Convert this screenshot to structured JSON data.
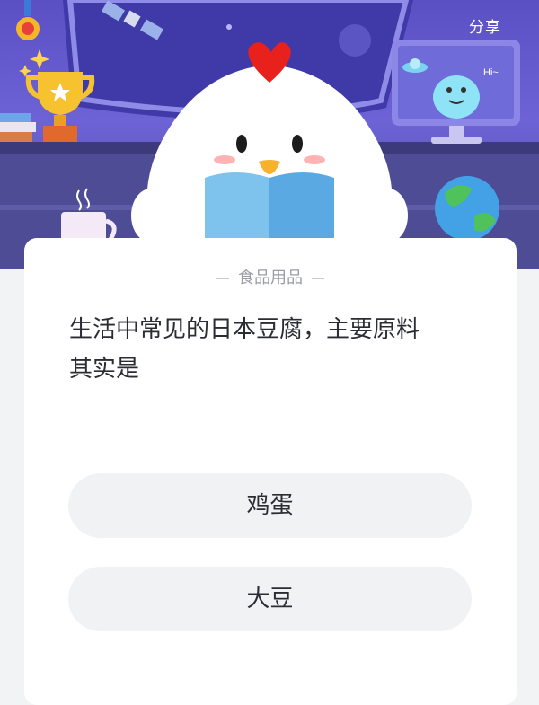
{
  "header": {
    "share_label": "分享",
    "screen_greeting": "Hi~"
  },
  "quiz": {
    "category": "食品用品",
    "question_line1": "生活中常见的日本豆腐，主要原料",
    "question_line2": "其实是",
    "options": [
      {
        "label": "鸡蛋"
      },
      {
        "label": "大豆"
      }
    ]
  },
  "colors": {
    "scene_purple": "#5b4fc4",
    "card_bg": "#ffffff",
    "option_bg": "#f1f2f4",
    "chick_comb": "#e8211c",
    "book_blue": "#7ec2ee"
  }
}
